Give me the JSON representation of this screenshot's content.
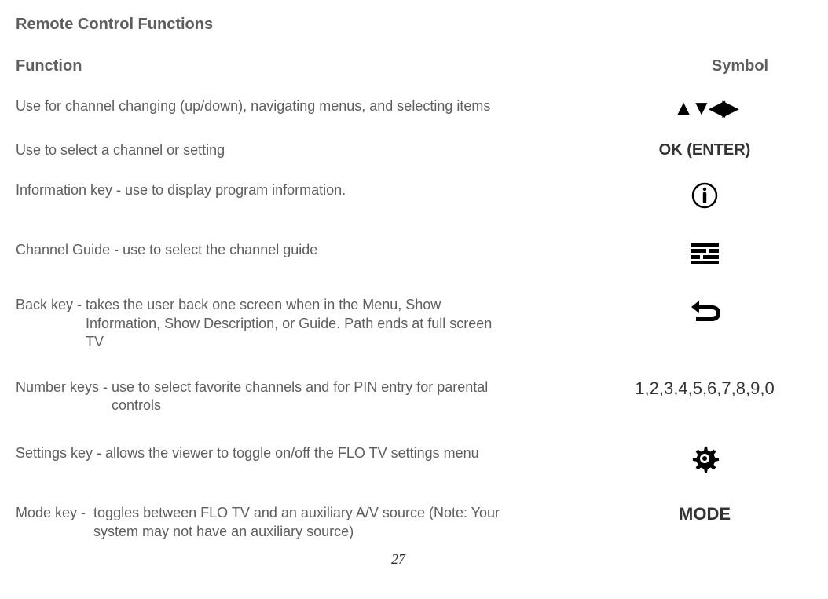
{
  "title": "Remote Control Functions",
  "headers": {
    "function": "Function",
    "symbol": "Symbol"
  },
  "rows": {
    "arrows": {
      "desc": "Use for channel changing (up/down), navigating menus, and selecting items",
      "symbol": "▲▼◀▶"
    },
    "ok": {
      "desc": "Use to select a channel or setting",
      "symbol": "OK (ENTER)"
    },
    "info": {
      "desc": "Information key - use to display program information."
    },
    "guide": {
      "desc": "Channel Guide - use to select the channel guide"
    },
    "back": {
      "label": "Back key - ",
      "body": "takes the user back one screen when in the Menu, Show Information, Show Description, or Guide. Path ends at full screen TV"
    },
    "numbers": {
      "label": "Number keys - ",
      "body": "use to select favorite channels and for PIN entry for parental controls",
      "symbol": "1,2,3,4,5,6,7,8,9,0"
    },
    "settings": {
      "desc": "Settings key - allows the viewer to toggle on/off the FLO TV settings menu"
    },
    "mode": {
      "label": "Mode key -  ",
      "body": "toggles between FLO TV and an auxiliary A/V source (Note: Your system may not have an auxiliary source)",
      "symbol": "MODE"
    }
  },
  "page_number": "27"
}
